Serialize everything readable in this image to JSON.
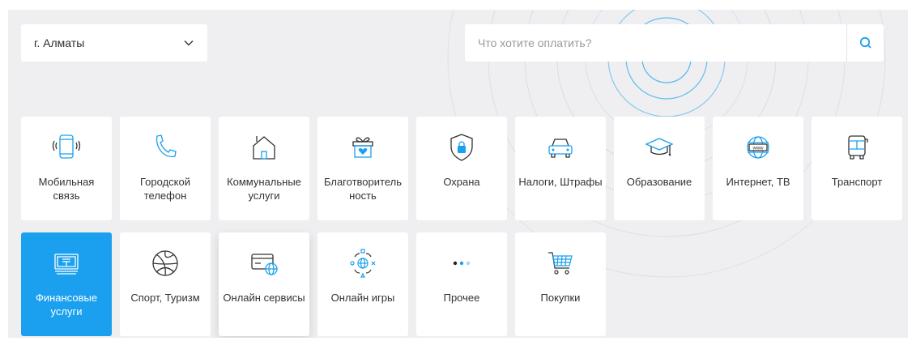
{
  "city": {
    "label": "г. Алматы"
  },
  "search": {
    "placeholder": "Что хотите оплатить?"
  },
  "colors": {
    "accent": "#1aa0ee",
    "background": "#efeff1",
    "tile": "#ffffff"
  },
  "categories_row1": [
    {
      "label": "Мобильная связь",
      "icon": "mobile-phone-icon"
    },
    {
      "label": "Городской телефон",
      "icon": "handset-icon"
    },
    {
      "label": "Коммунальные услуги",
      "icon": "house-icon"
    },
    {
      "label": "Благотворитель ность",
      "icon": "gift-heart-icon"
    },
    {
      "label": "Охрана",
      "icon": "shield-lock-icon"
    },
    {
      "label": "Налоги, Штрафы",
      "icon": "car-icon"
    },
    {
      "label": "Образование",
      "icon": "graduation-cap-icon"
    },
    {
      "label": "Интернет, ТВ",
      "icon": "globe-www-icon"
    },
    {
      "label": "Транспорт",
      "icon": "bus-icon"
    }
  ],
  "categories_row2": [
    {
      "label": "Финансовые услуги",
      "icon": "tenge-banknote-icon",
      "active": true
    },
    {
      "label": "Спорт, Туризм",
      "icon": "ball-icon"
    },
    {
      "label": "Онлайн сервисы",
      "icon": "card-globe-icon"
    },
    {
      "label": "Онлайн игры",
      "icon": "globe-controls-icon"
    },
    {
      "label": "Прочее",
      "icon": "dots-icon"
    },
    {
      "label": "Покупки",
      "icon": "cart-icon"
    }
  ]
}
